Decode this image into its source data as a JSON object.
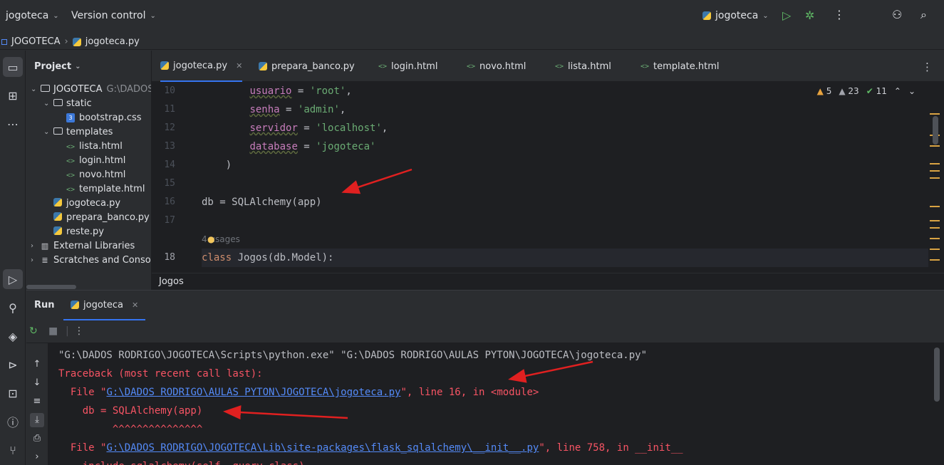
{
  "topbar": {
    "project": "jogoteca",
    "vcs": "Version control",
    "run_config": "jogoteca"
  },
  "breadcrumb": {
    "root": "JOGOTECA",
    "file": "jogoteca.py"
  },
  "project_panel": {
    "title": "Project",
    "tree": [
      {
        "label": "JOGOTECA",
        "path": "G:\\DADOS",
        "type": "folder",
        "depth": 0,
        "expanded": true
      },
      {
        "label": "static",
        "type": "folder",
        "depth": 1,
        "expanded": true
      },
      {
        "label": "bootstrap.css",
        "type": "css",
        "depth": 2
      },
      {
        "label": "templates",
        "type": "folder",
        "depth": 1,
        "expanded": true
      },
      {
        "label": "lista.html",
        "type": "html",
        "depth": 2
      },
      {
        "label": "login.html",
        "type": "html",
        "depth": 2
      },
      {
        "label": "novo.html",
        "type": "html",
        "depth": 2
      },
      {
        "label": "template.html",
        "type": "html",
        "depth": 2
      },
      {
        "label": "jogoteca.py",
        "type": "py",
        "depth": 1
      },
      {
        "label": "prepara_banco.py",
        "type": "py",
        "depth": 1
      },
      {
        "label": "reste.py",
        "type": "py",
        "depth": 1
      },
      {
        "label": "External Libraries",
        "type": "lib",
        "depth": 0
      },
      {
        "label": "Scratches and Conso",
        "type": "scratch",
        "depth": 0
      }
    ]
  },
  "editor": {
    "tabs": [
      {
        "label": "jogoteca.py",
        "type": "py",
        "active": true
      },
      {
        "label": "prepara_banco.py",
        "type": "py"
      },
      {
        "label": "login.html",
        "type": "html"
      },
      {
        "label": "novo.html",
        "type": "html"
      },
      {
        "label": "lista.html",
        "type": "html"
      },
      {
        "label": "template.html",
        "type": "html"
      }
    ],
    "inspections": {
      "warnings": "5",
      "weak_warnings": "23",
      "ok": "11"
    },
    "line_numbers": [
      "10",
      "11",
      "12",
      "13",
      "14",
      "15",
      "16",
      "17",
      "",
      "18"
    ],
    "code": {
      "l10_name": "usuario",
      "l10_val": "'root'",
      "l11_name": "senha",
      "l11_val": "'admin'",
      "l12_name": "servidor",
      "l12_val": "'localhost'",
      "l13_name": "database",
      "l13_val": "'jogoteca'",
      "l14": ")",
      "l16": "db = SQLAlchemy(app)",
      "usages": "4 usages",
      "l18_kw": "class",
      "l18_rest": " Jogos(db.Model):"
    },
    "structure_crumb": "Jogos"
  },
  "run": {
    "title": "Run",
    "tab": "jogoteca",
    "console": {
      "cmd": "\"G:\\DADOS RODRIGO\\JOGOTECA\\Scripts\\python.exe\" \"G:\\DADOS RODRIGO\\AULAS PYTON\\JOGOTECA\\jogoteca.py\"",
      "traceback": "Traceback (most recent call last):",
      "f1_pre": "  File \"",
      "f1_link": "G:\\DADOS RODRIGO\\AULAS PYTON\\JOGOTECA\\jogoteca.py",
      "f1_post": "\", line 16, in <module>",
      "code1": "    db = SQLAlchemy(app)",
      "caret1": "         ^^^^^^^^^^^^^^^",
      "f2_pre": "  File \"",
      "f2_link": "G:\\DADOS RODRIGO\\JOGOTECA\\Lib\\site-packages\\flask_sqlalchemy\\__init__.py",
      "f2_post": "\", line 758, in __init__",
      "code2": "    include_sqlalchemy(self, query_class)"
    }
  },
  "colors": {
    "accent": "#3574f0",
    "error": "#f75464",
    "link": "#548af7",
    "annotation_arrow": "#e02020"
  }
}
